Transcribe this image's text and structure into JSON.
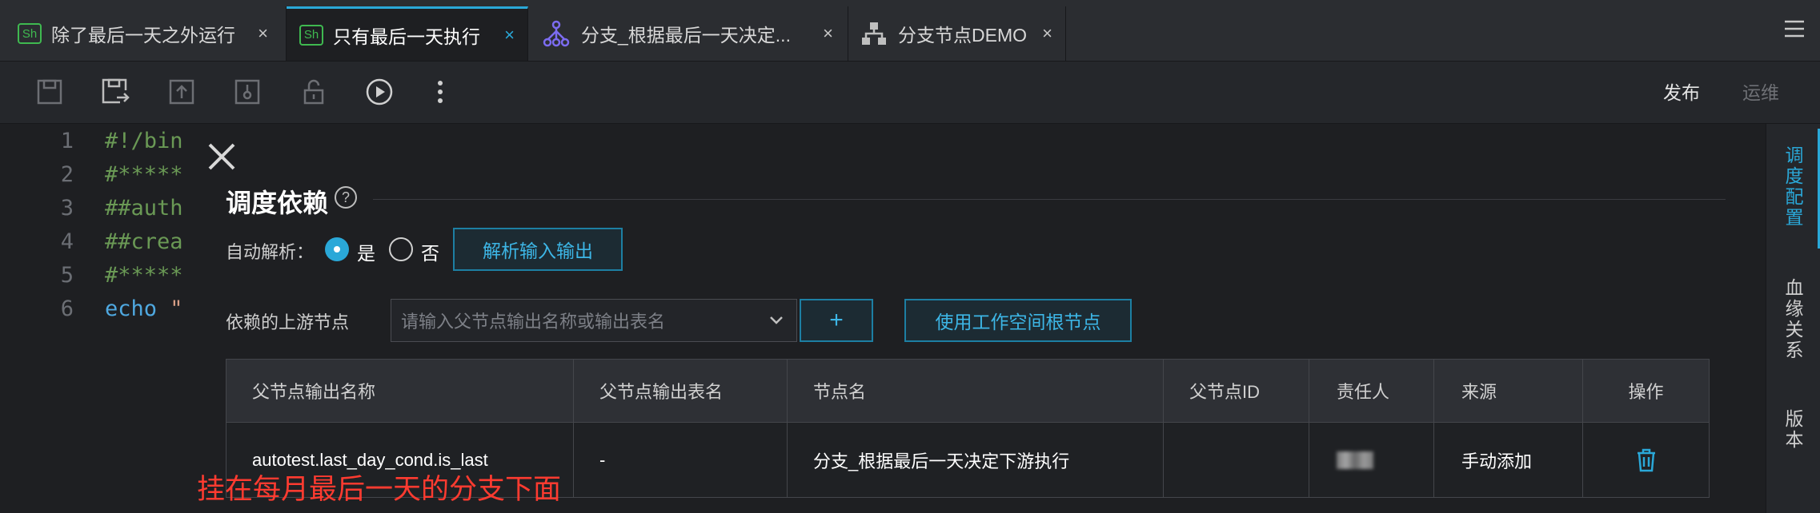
{
  "tabs": [
    {
      "label": "除了最后一天之外运行",
      "icon": "shell-icon",
      "icon_text": "Sh",
      "active": false
    },
    {
      "label": "只有最后一天执行",
      "icon": "shell-icon",
      "icon_text": "Sh",
      "active": true
    },
    {
      "label": "分支_根据最后一天决定...",
      "icon": "branch-icon",
      "active": false
    },
    {
      "label": "分支节点DEMO",
      "icon": "flow-node-icon",
      "active": false
    }
  ],
  "tab_close": "×",
  "toolbar": {
    "icons": [
      "save-icon",
      "save-as-icon",
      "submit-icon",
      "steal-lock-icon",
      "unlock-icon",
      "run-icon",
      "more-icon"
    ],
    "publish_label": "发布",
    "ops_label": "运维"
  },
  "editor": {
    "lines": [
      {
        "num": "1",
        "text": "#!/bin"
      },
      {
        "num": "2",
        "text": "#*****"
      },
      {
        "num": "3",
        "text": "##auth"
      },
      {
        "num": "4",
        "text": "##crea"
      },
      {
        "num": "5",
        "text": "#*****"
      },
      {
        "num": "6",
        "kw": "echo",
        "str": " \""
      }
    ]
  },
  "right_panel": {
    "tabs": [
      {
        "label": "调度配置",
        "active": true
      },
      {
        "label": "血缘关系",
        "active": false
      },
      {
        "label": "版本",
        "active": false
      }
    ]
  },
  "dialog": {
    "title": "调度依赖",
    "help": "?",
    "auto_parse_label": "自动解析：",
    "option_yes": "是",
    "option_no": "否",
    "auto_parse_selected": "是",
    "parse_button": "解析输入输出",
    "upstream_label": "依赖的上游节点",
    "upstream_placeholder": "请输入父节点输出名称或输出表名",
    "add_button": "+",
    "root_button": "使用工作空间根节点"
  },
  "table": {
    "columns": [
      "父节点输出名称",
      "父节点输出表名",
      "节点名",
      "父节点ID",
      "责任人",
      "来源",
      "操作"
    ],
    "rows": [
      {
        "output_name": "autotest.last_day_cond.is_last",
        "output_table": "-",
        "node_name": "分支_根据最后一天决定下游执行",
        "node_id": "",
        "owner": "",
        "source": "手动添加",
        "action_icon": "trash-icon"
      }
    ]
  },
  "annotation": "挂在每月最后一天的分支下面",
  "colors": {
    "accent": "#2aa8d8",
    "shell_green": "#3fb950",
    "annotation_red": "#ff3b30"
  }
}
